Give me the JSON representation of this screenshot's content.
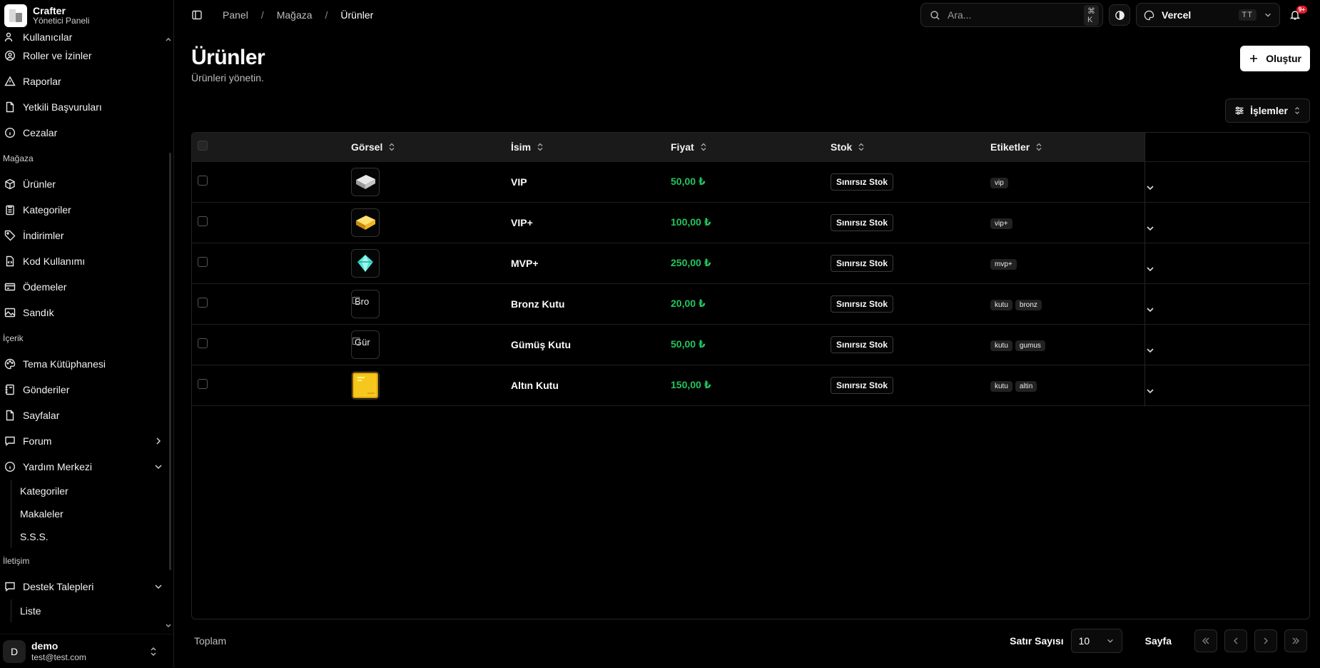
{
  "brand": {
    "name": "Crafter",
    "subtitle": "Yönetici Paneli"
  },
  "sidebar": {
    "items_top": [
      {
        "label": "Kullanıcılar",
        "icon": "users-icon"
      },
      {
        "label": "Roller ve İzinler",
        "icon": "user-circle-icon"
      },
      {
        "label": "Raporlar",
        "icon": "warning-triangle-icon"
      },
      {
        "label": "Yetkili Başvuruları",
        "icon": "file-icon"
      },
      {
        "label": "Cezalar",
        "icon": "info-circle-icon"
      }
    ],
    "group_store": "Mağaza",
    "items_store": [
      {
        "label": "Ürünler",
        "icon": "box-icon"
      },
      {
        "label": "Kategoriler",
        "icon": "clipboard-icon"
      },
      {
        "label": "İndirimler",
        "icon": "tag-icon"
      },
      {
        "label": "Kod Kullanımı",
        "icon": "code-file-icon"
      },
      {
        "label": "Ödemeler",
        "icon": "credit-card-icon"
      },
      {
        "label": "Sandık",
        "icon": "image-icon"
      }
    ],
    "group_content": "İçerik",
    "items_content": [
      {
        "label": "Tema Kütüphanesi",
        "icon": "palette-icon"
      },
      {
        "label": "Gönderiler",
        "icon": "notebook-icon"
      },
      {
        "label": "Sayfalar",
        "icon": "page-icon"
      },
      {
        "label": "Forum",
        "icon": "chat-icon"
      },
      {
        "label": "Yardım Merkezi",
        "icon": "info-circle-icon"
      }
    ],
    "help_sub": [
      "Kategoriler",
      "Makaleler",
      "S.S.S."
    ],
    "group_contact": "İletişim",
    "items_contact": [
      {
        "label": "Destek Talepleri",
        "icon": "chat-icon"
      }
    ],
    "support_sub": [
      "Liste"
    ]
  },
  "user": {
    "initial": "D",
    "name": "demo",
    "email": "test@test.com"
  },
  "topbar": {
    "breadcrumb": [
      "Panel",
      "Mağaza",
      "Ürünler"
    ],
    "search_placeholder": "Ara...",
    "search_shortcut": "⌘ K",
    "team_name": "Vercel",
    "team_initials": "TT",
    "notif_badge": "9+"
  },
  "page": {
    "title": "Ürünler",
    "subtitle": "Ürünleri yönetin.",
    "create_label": "Oluştur",
    "actions_label": "İşlemler"
  },
  "table": {
    "columns": [
      "Görsel",
      "İsim",
      "Fiyat",
      "Stok",
      "Etiketler"
    ],
    "rows": [
      {
        "image": "iron-ingot",
        "name": "VIP",
        "price": "50,00 ₺",
        "stock": "Sınırsız Stok",
        "tags": [
          "vip"
        ]
      },
      {
        "image": "gold-ingot",
        "name": "VIP+",
        "price": "100,00 ₺",
        "stock": "Sınırsız Stok",
        "tags": [
          "vip+"
        ]
      },
      {
        "image": "diamond",
        "name": "MVP+",
        "price": "250,00 ₺",
        "stock": "Sınırsız Stok",
        "tags": [
          "mvp+"
        ]
      },
      {
        "image": "broken",
        "image_alt": "Bro",
        "name": "Bronz Kutu",
        "price": "20,00 ₺",
        "stock": "Sınırsız Stok",
        "tags": [
          "kutu",
          "bronz"
        ]
      },
      {
        "image": "broken",
        "image_alt": "Gür",
        "name": "Gümüş Kutu",
        "price": "50,00 ₺",
        "stock": "Sınırsız Stok",
        "tags": [
          "kutu",
          "gumus"
        ]
      },
      {
        "image": "gold-block",
        "name": "Altın Kutu",
        "price": "150,00 ₺",
        "stock": "Sınırsız Stok",
        "tags": [
          "kutu",
          "altin"
        ]
      }
    ]
  },
  "footer": {
    "total_label": "Toplam",
    "rows_label": "Satır Sayısı",
    "rows_value": "10",
    "page_label": "Sayfa"
  },
  "colors": {
    "price": "#22c55e",
    "badge": "#e11d2e",
    "background": "#000000"
  }
}
